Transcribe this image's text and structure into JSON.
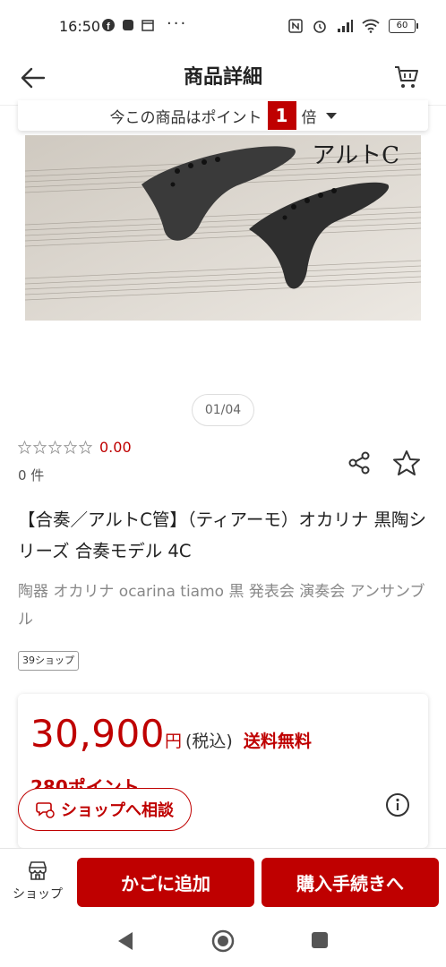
{
  "status_bar": {
    "time": "16:50",
    "battery": "60",
    "dots": "···"
  },
  "header": {
    "title": "商品詳細"
  },
  "point_banner": {
    "text_before": "今この商品はポイント",
    "multiplier": "1",
    "text_after": "倍"
  },
  "product_image": {
    "caption": "アルトC"
  },
  "pager": "01/04",
  "rating": {
    "value": "0.00",
    "count": "0 件",
    "stars_filled": 0,
    "stars_total": 5
  },
  "product": {
    "title": "【合奏／アルトC管】（ティアーモ）オカリナ 黒陶シリーズ 合奏モデル 4C",
    "tags": "陶器 オカリナ ocarina tiamo 黒 発表会 演奏会 アンサンブル",
    "shop_badge": "39ショップ"
  },
  "price": {
    "amount": "30,900",
    "yen": "円",
    "tax": "(税込)",
    "shipping": "送料無料",
    "points": "280ポイント"
  },
  "consult_button": "ショップへ相談",
  "action_bar": {
    "shop_label": "ショップ",
    "add_cart": "かごに追加",
    "checkout": "購入手続きへ"
  },
  "colors": {
    "accent": "#bf0000"
  }
}
